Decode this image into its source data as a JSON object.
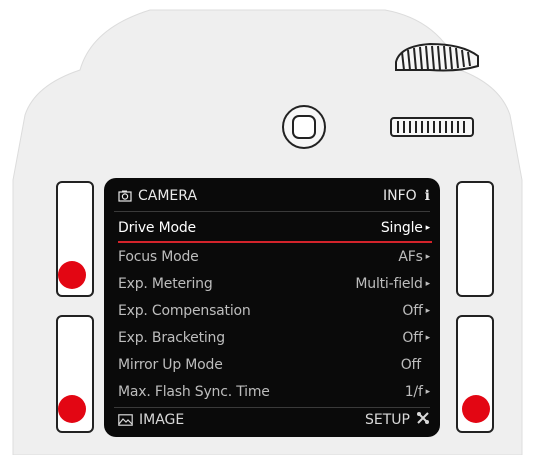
{
  "header": {
    "section": "CAMERA",
    "info": "INFO"
  },
  "menu": [
    {
      "label": "Drive Mode",
      "value": "Single",
      "arrow": true,
      "selected": true
    },
    {
      "label": "Focus Mode",
      "value": "AFs",
      "arrow": true
    },
    {
      "label": "Exp. Metering",
      "value": "Multi-field",
      "arrow": true
    },
    {
      "label": "Exp. Compensation",
      "value": "Off",
      "arrow": true
    },
    {
      "label": "Exp. Bracketing",
      "value": "Off",
      "arrow": true
    },
    {
      "label": "Mirror Up Mode",
      "value": "Off",
      "arrow": false
    },
    {
      "label": "Max. Flash Sync. Time",
      "value": "1/f",
      "arrow": true
    }
  ],
  "footer": {
    "left": "IMAGE",
    "right": "SETUP"
  },
  "colors": {
    "accent": "#e30613",
    "screen": "#0a0a0a",
    "body": "#efefef"
  },
  "icons": [
    "camera-icon",
    "info-icon",
    "image-icon",
    "wrench-icon",
    "thumbwheel-icon",
    "joystick-icon",
    "dial-icon"
  ]
}
